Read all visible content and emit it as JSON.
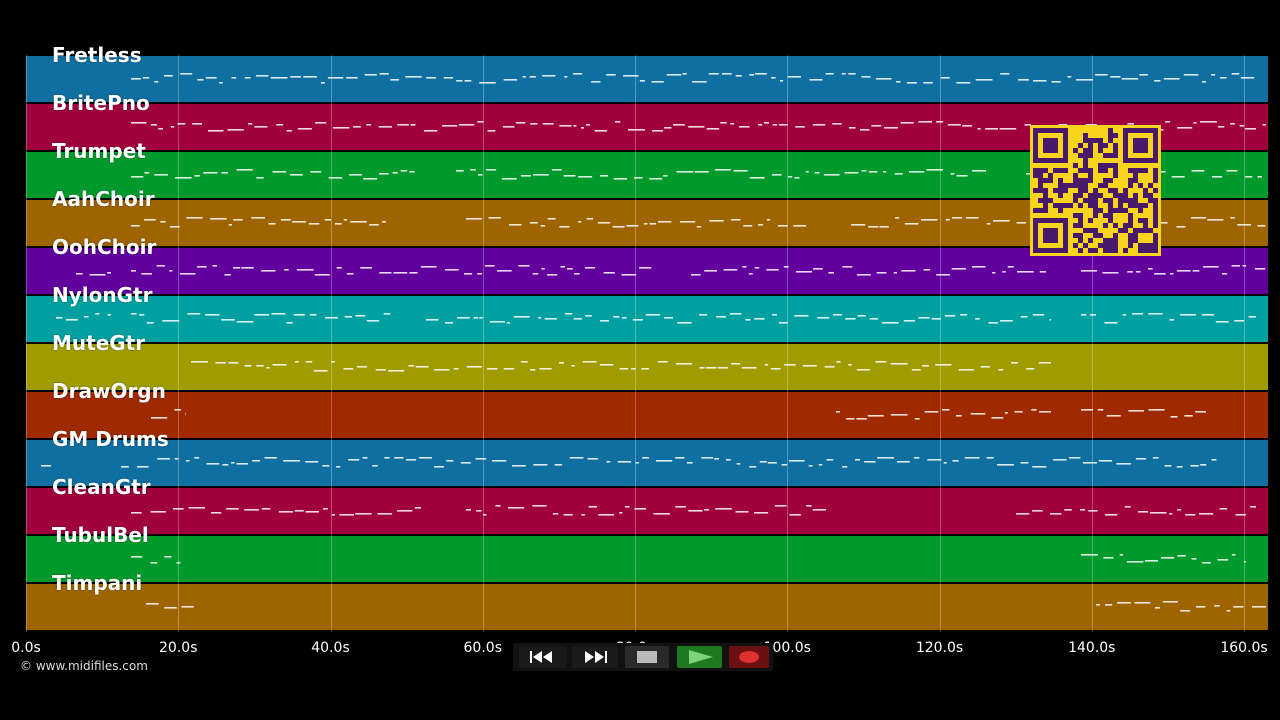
{
  "tracks": [
    {
      "name": "Fretless",
      "color": "#0f6fa0"
    },
    {
      "name": "BritePno",
      "color": "#a0003e"
    },
    {
      "name": "Trumpet",
      "color": "#009a2c"
    },
    {
      "name": "AahChoir",
      "color": "#9e6400"
    },
    {
      "name": "OohChoir",
      "color": "#62009e"
    },
    {
      "name": "NylonGtr",
      "color": "#00a0a0"
    },
    {
      "name": "MuteGtr",
      "color": "#a09c00"
    },
    {
      "name": "DrawOrgn",
      "color": "#a02a00"
    },
    {
      "name": "GM Drums",
      "color": "#0f6fa0"
    },
    {
      "name": "CleanGtr",
      "color": "#a0003e"
    },
    {
      "name": "TubulBel",
      "color": "#009a2c"
    },
    {
      "name": "Timpani",
      "color": "#9e6400"
    }
  ],
  "time_axis": {
    "ticks": [
      "0.0s",
      "20.0s",
      "40.0s",
      "60.0s",
      "80.0s",
      "100.0s",
      "120.0s",
      "140.0s",
      "160.0s"
    ],
    "tick_values": [
      0,
      20,
      40,
      60,
      80,
      100,
      120,
      140,
      160
    ]
  },
  "copyright": "© www.midifiles.com",
  "transport": {
    "rewind": "rewind-icon",
    "fast_forward": "fast-forward-icon",
    "stop": "stop-icon",
    "play": "play-icon",
    "record": "record-icon"
  },
  "qr_code": "qr-code-icon"
}
